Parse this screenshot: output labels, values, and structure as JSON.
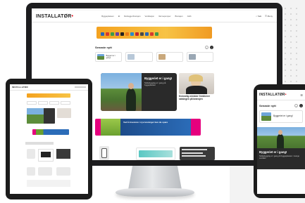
{
  "brand": {
    "logo_text": "INSTALLATØR",
    "accent": "#e30613"
  },
  "desktop": {
    "nav": [
      "Byggeplassen",
      "El",
      "Rørleggerbransjen",
      "Ventilasjon",
      "Varmepumper",
      "Bransjen",
      "Jobb"
    ],
    "tools": {
      "search": "Søk",
      "menu": "Meny",
      "login": "Logg inn",
      "subscribe": "Abonner"
    },
    "section_title": "Senaste nytt",
    "cards": [
      {
        "text": "Byggeri er i gang!"
      },
      {
        "text": ""
      },
      {
        "text": ""
      },
      {
        "text": ""
      }
    ],
    "hero": {
      "title": "Byggeriet er i gang!",
      "subtitle": "Stöttebygging er i gang på byggeplassen"
    },
    "side_article": {
      "title": "Kvinnelig minister fremhever satsingen på bransjen",
      "subtitle": ""
    },
    "ad_text": "Ved å investere i nye løsninger kan du spare"
  },
  "tablet": {
    "logo_text": "INSTALLATØR"
  },
  "phone": {
    "logo_text": "INSTALLATØR",
    "section_title": "Senaste nytt",
    "card_text": "Byggeriet er i gang!",
    "hero_title": "Byggeriet er i gang!",
    "hero_sub": "Stöttebygging er i gang på byggeplassen i mange områder"
  }
}
